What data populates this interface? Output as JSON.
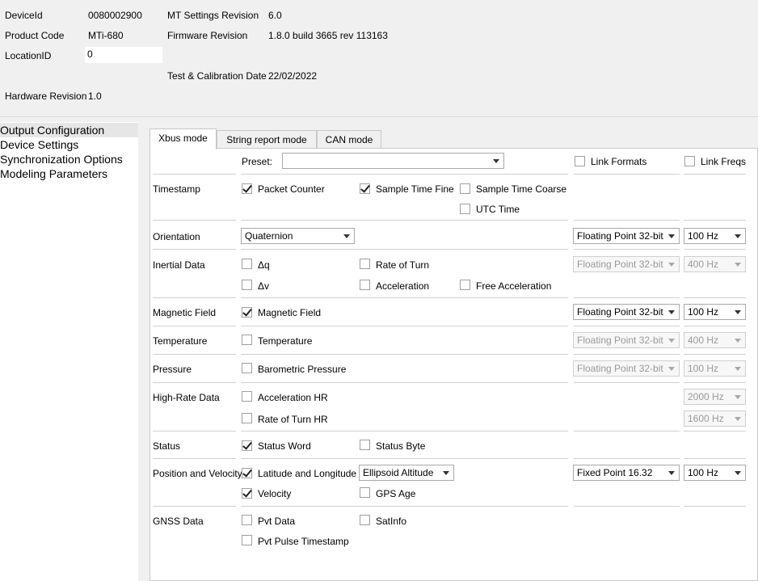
{
  "device": {
    "device_id_label": "DeviceId",
    "device_id": "0080002900",
    "product_code_label": "Product Code",
    "product_code": "MTi-680",
    "location_id_label": "LocationID",
    "location_id": "0",
    "hardware_revision_label": "Hardware Revision",
    "hardware_revision": "1.0",
    "mt_settings_revision_label": "MT Settings Revision",
    "mt_settings_revision": "6.0",
    "firmware_revision_label": "Firmware Revision",
    "firmware_revision": "1.8.0 build 3665 rev 113163",
    "test_cal_date_label": "Test & Calibration Date",
    "test_cal_date": "22/02/2022"
  },
  "nav": {
    "items": [
      "Output Configuration",
      "Device Settings",
      "Synchronization Options",
      "Modeling Parameters"
    ]
  },
  "tabs": [
    "Xbus mode",
    "String report mode",
    "CAN mode"
  ],
  "panel": {
    "preset_label": "Preset:",
    "preset_value": "",
    "link_formats": "Link Formats",
    "link_freqs": "Link Freqs"
  },
  "rows": {
    "timestamp": {
      "label": "Timestamp",
      "packet_counter": "Packet Counter",
      "sample_time_fine": "Sample Time Fine",
      "sample_time_coarse": "Sample Time Coarse",
      "utc_time": "UTC Time"
    },
    "orientation": {
      "label": "Orientation",
      "mode": "Quaternion",
      "format": "Floating Point 32-bit",
      "freq": "100 Hz"
    },
    "inertial": {
      "label": "Inertial Data",
      "dq": "Δq",
      "dv": "Δv",
      "rate_of_turn": "Rate of Turn",
      "acceleration": "Acceleration",
      "free_acceleration": "Free Acceleration",
      "format": "Floating Point 32-bit",
      "freq": "400 Hz"
    },
    "magnetic": {
      "label": "Magnetic Field",
      "magnetic_field": "Magnetic Field",
      "format": "Floating Point 32-bit",
      "freq": "100 Hz"
    },
    "temperature": {
      "label": "Temperature",
      "temperature": "Temperature",
      "format": "Floating Point 32-bit",
      "freq": "400 Hz"
    },
    "pressure": {
      "label": "Pressure",
      "barometric": "Barometric Pressure",
      "format": "Floating Point 32-bit",
      "freq": "100 Hz"
    },
    "high_rate": {
      "label": "High-Rate Data",
      "acc_hr": "Acceleration HR",
      "rot_hr": "Rate of Turn HR",
      "acc_freq": "2000 Hz",
      "rot_freq": "1600 Hz"
    },
    "status": {
      "label": "Status",
      "status_word": "Status Word",
      "status_byte": "Status Byte"
    },
    "position": {
      "label": "Position and Velocity",
      "lat_lon": "Latitude and Longitude",
      "altitude_mode": "Ellipsoid Altitude",
      "velocity": "Velocity",
      "gps_age": "GPS Age",
      "format": "Fixed Point 16.32",
      "freq": "100 Hz"
    },
    "gnss": {
      "label": "GNSS Data",
      "pvt_data": "Pvt Data",
      "satinfo": "SatInfo",
      "pvt_pulse": "Pvt Pulse Timestamp"
    }
  }
}
